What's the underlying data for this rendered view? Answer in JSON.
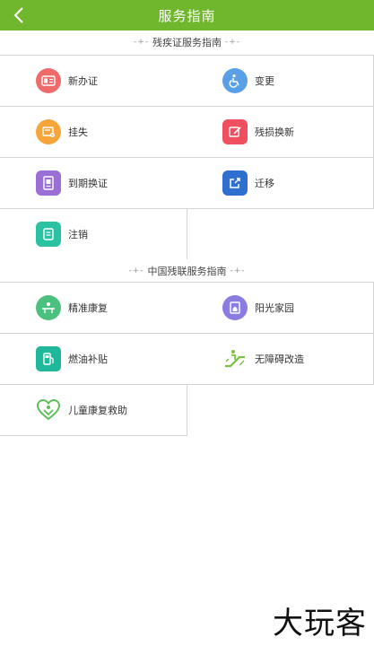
{
  "header": {
    "title": "服务指南"
  },
  "sections": [
    {
      "title": "残疾证服务指南",
      "items": [
        {
          "label": "新办证",
          "icon": "id-card-icon",
          "color": "#ef6a6a"
        },
        {
          "label": "变更",
          "icon": "wheelchair-icon",
          "color": "#5ba0e6"
        },
        {
          "label": "挂失",
          "icon": "card-lost-icon",
          "color": "#f5a53a"
        },
        {
          "label": "残损换新",
          "icon": "edit-card-icon",
          "color": "#ef4f5f"
        },
        {
          "label": "到期换证",
          "icon": "document-icon",
          "color": "#9a6fd6"
        },
        {
          "label": "迁移",
          "icon": "export-icon",
          "color": "#2f6fd0"
        },
        {
          "label": "注销",
          "icon": "cancel-card-icon",
          "color": "#2bc2a4"
        }
      ]
    },
    {
      "title": "中国残联服务指南",
      "items": [
        {
          "label": "精准康复",
          "icon": "rehab-icon",
          "color": "#4cc07f"
        },
        {
          "label": "阳光家园",
          "icon": "home-icon",
          "color": "#8a7ce0"
        },
        {
          "label": "燃油补贴",
          "icon": "fuel-icon",
          "color": "#1fb89a"
        },
        {
          "label": "无障碍改造",
          "icon": "escalator-icon",
          "color": "#7ac142"
        },
        {
          "label": "儿童康复救助",
          "icon": "child-heart-icon",
          "color": "#5cbf5a"
        }
      ]
    }
  ],
  "decor": {
    "left": "-+-",
    "right": "-+-"
  },
  "watermark": "大玩客",
  "colors": {
    "green": "#70b72e",
    "border": "#d4d4d4"
  }
}
